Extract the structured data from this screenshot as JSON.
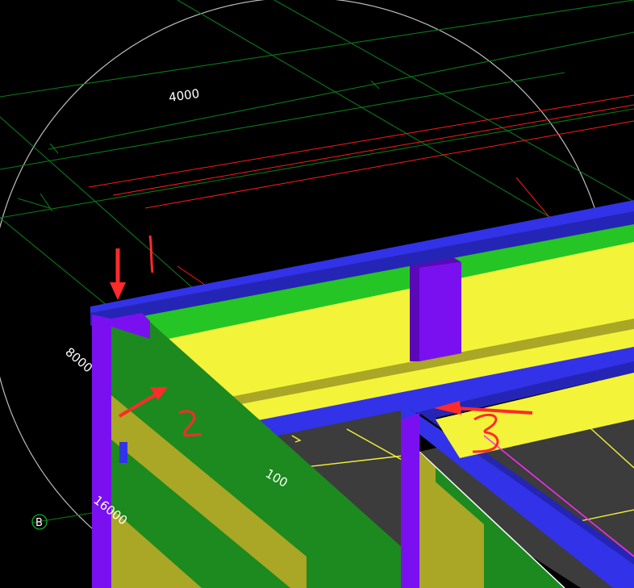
{
  "viewport": {
    "dimensions": [
      "4000",
      "8000",
      "16000",
      "100"
    ],
    "axis_label": "B",
    "annotations": [
      "1",
      "2",
      "3"
    ]
  },
  "colors": {
    "background": "#000000",
    "grid": "#0a7a1a",
    "reference": "#ff1a1a",
    "beam_blue": "#3232e8",
    "beam_blue_dark": "#2525b5",
    "column_purple": "#7a10f0",
    "column_purple_dark": "#5a08b8",
    "wall_green": "#26c526",
    "wall_green_dark": "#1c8a1e",
    "wall_yellow": "#f3f33a",
    "wall_yellow_dark": "#aaa626",
    "floor_gray": "#3c3c3c",
    "annotation_red": "#ff2a2a",
    "magenta": "#ff2aff"
  }
}
